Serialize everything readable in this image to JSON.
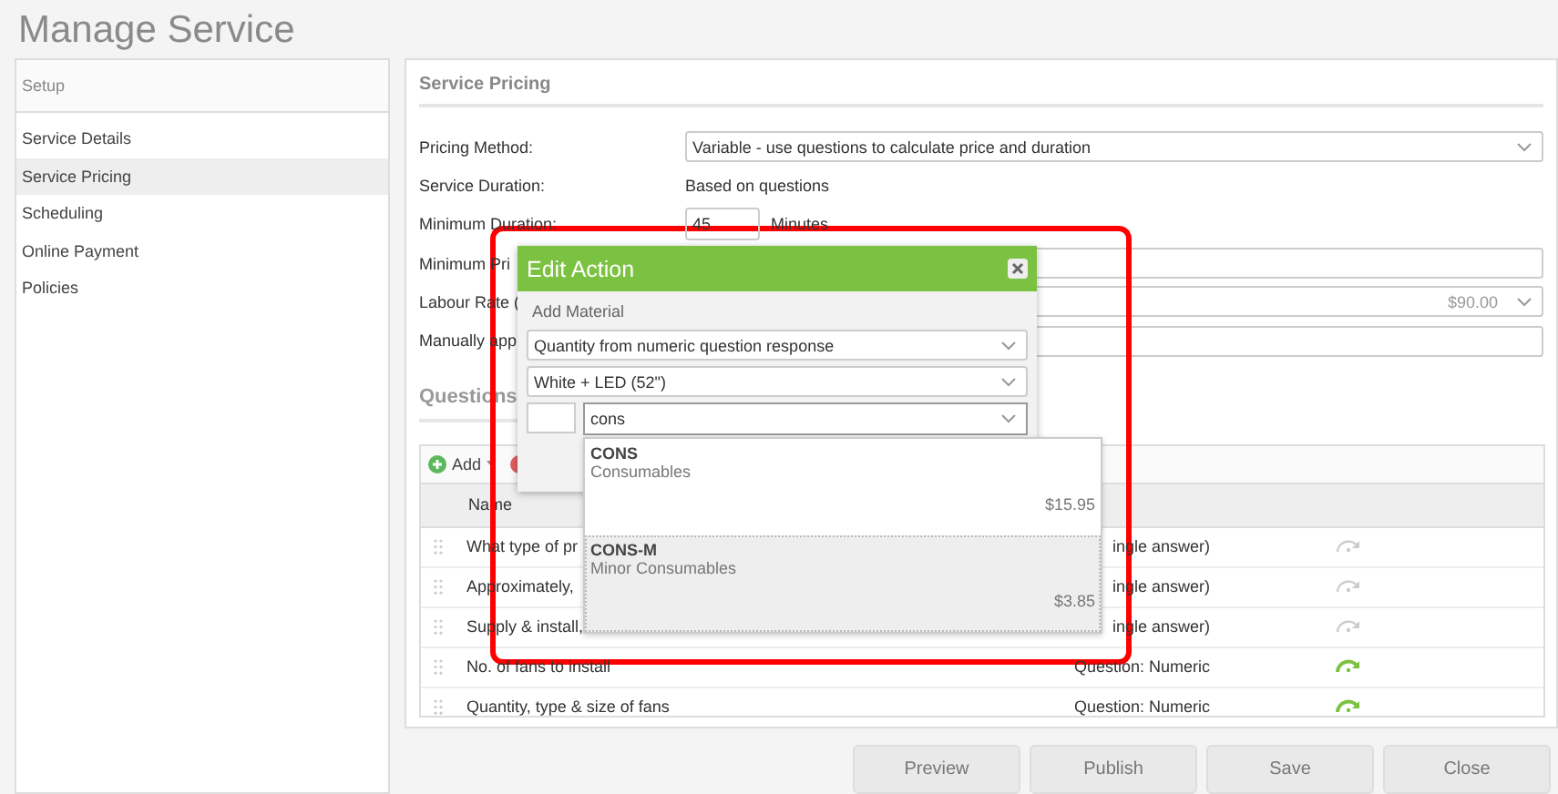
{
  "page_title": "Manage Service",
  "sidebar": {
    "title": "Setup",
    "items": [
      {
        "label": "Service Details",
        "selected": false
      },
      {
        "label": "Service Pricing",
        "selected": true
      },
      {
        "label": "Scheduling",
        "selected": false
      },
      {
        "label": "Online Payment",
        "selected": false
      },
      {
        "label": "Policies",
        "selected": false
      }
    ]
  },
  "section_title": "Service Pricing",
  "form": [
    {
      "kind": "select",
      "label": "Pricing Method:",
      "value": "Variable - use questions to calculate price and duration"
    },
    {
      "kind": "text",
      "label": "Service Duration:",
      "value": "Based on questions"
    },
    {
      "kind": "number",
      "label": "Minimum Duration:",
      "value": "45",
      "unit": "Minutes"
    },
    {
      "kind": "input",
      "label": "Minimum Pri"
    },
    {
      "kind": "select",
      "label": "Labour Rate (",
      "value": "$90.00"
    },
    {
      "kind": "input",
      "label": "Manually app"
    }
  ],
  "questions_title": "Questions",
  "toolbar": {
    "add": "Add"
  },
  "table": {
    "columns": [
      "Name"
    ],
    "rows": [
      {
        "name": "What type of pr",
        "type": "ingle answer)",
        "active": false
      },
      {
        "name": "Approximately,",
        "type": "ingle answer)",
        "active": false
      },
      {
        "name": "Supply & install,",
        "type": "ingle answer)",
        "active": false
      },
      {
        "name": "No. of fans to install",
        "type": "Question: Numeric",
        "active": true
      },
      {
        "name": "Quantity, type & size of fans",
        "type": "Question: Numeric",
        "active": true
      }
    ]
  },
  "buttons": [
    "Preview",
    "Publish",
    "Save",
    "Close"
  ],
  "dialog": {
    "title": "Edit Action",
    "section": "Add Material",
    "quantity_select": "Quantity from numeric question response",
    "variant_select": "White + LED (52\")",
    "search_value": "cons",
    "options": [
      {
        "code": "CONS",
        "name": "Consumables",
        "price": "$15.95",
        "selected": false
      },
      {
        "code": "CONS-M",
        "name": "Minor Consumables",
        "price": "$3.85",
        "selected": true
      }
    ]
  }
}
